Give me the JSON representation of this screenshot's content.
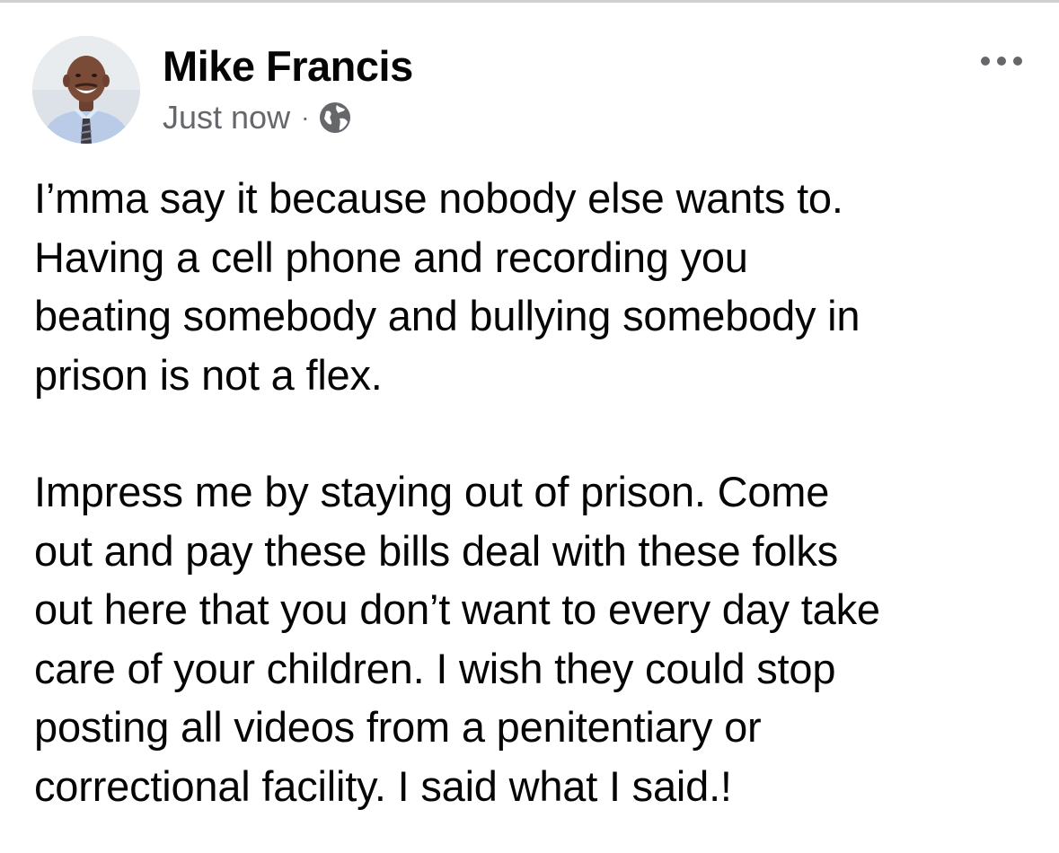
{
  "post": {
    "author": "Mike Francis",
    "timestamp": "Just now",
    "separator": "·",
    "privacy_icon": "globe-icon",
    "more_icon": "more-horizontal-icon",
    "paragraphs": [
      "I’mma say it because nobody else wants to.\nHaving a cell phone and recording you\nbeating somebody and bullying somebody in\nprison is not a flex.",
      "Impress me by staying out of prison. Come\nout and pay these bills deal with these folks\nout here that you don’t want to every day take\ncare of your children. I wish they could stop\nposting all videos from a penitentiary or\ncorrectional facility. I said what I said.!"
    ]
  },
  "colors": {
    "text": "#050505",
    "secondary_text": "#65676b",
    "background": "#ffffff"
  }
}
